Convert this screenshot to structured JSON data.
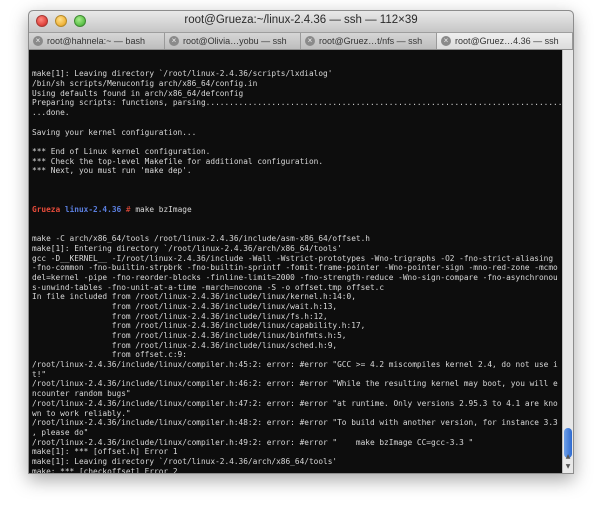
{
  "window": {
    "title": "root@Grueza:~/linux-2.4.36 — ssh — 112×39"
  },
  "tabs": [
    {
      "label": "root@hahnela:~ — bash"
    },
    {
      "label": "root@Olivia…yobu — ssh"
    },
    {
      "label": "root@Gruez…t/nfs — ssh"
    },
    {
      "label": "root@Gruez…4.36 — ssh",
      "active": true
    }
  ],
  "prompt": {
    "host": "Grueza",
    "cwd": "linux-2.4.36",
    "symbol": "#",
    "command": "make bzImage"
  },
  "terminal": {
    "lines_before": [
      "make[1]: Leaving directory `/root/linux-2.4.36/scripts/lxdialog'",
      "/bin/sh scripts/Menuconfig arch/x86_64/config.in",
      "Using defaults found in arch/x86_64/defconfig",
      "Preparing scripts: functions, parsing.................................................................................",
      "...done.",
      "",
      "Saving your kernel configuration...",
      "",
      "*** End of Linux kernel configuration.",
      "*** Check the top-level Makefile for additional configuration.",
      "*** Next, you must run 'make dep'.",
      ""
    ],
    "lines_after": [
      "make -C arch/x86_64/tools /root/linux-2.4.36/include/asm-x86_64/offset.h",
      "make[1]: Entering directory `/root/linux-2.4.36/arch/x86_64/tools'",
      "gcc -D__KERNEL__ -I/root/linux-2.4.36/include -Wall -Wstrict-prototypes -Wno-trigraphs -O2 -fno-strict-aliasing",
      "-fno-common -fno-builtin-strpbrk -fno-builtin-sprintf -fomit-frame-pointer -Wno-pointer-sign -mno-red-zone -mcmo",
      "del=kernel -pipe -fno-reorder-blocks -finline-limit=2000 -fno-strength-reduce -Wno-sign-compare -fno-asynchronou",
      "s-unwind-tables -fno-unit-at-a-time -march=nocona -S -o offset.tmp offset.c",
      "In file included from /root/linux-2.4.36/include/linux/kernel.h:14:0,",
      "                 from /root/linux-2.4.36/include/linux/wait.h:13,",
      "                 from /root/linux-2.4.36/include/linux/fs.h:12,",
      "                 from /root/linux-2.4.36/include/linux/capability.h:17,",
      "                 from /root/linux-2.4.36/include/linux/binfmts.h:5,",
      "                 from /root/linux-2.4.36/include/linux/sched.h:9,",
      "                 from offset.c:9:",
      "/root/linux-2.4.36/include/linux/compiler.h:45:2: error: #error \"GCC >= 4.2 miscompiles kernel 2.4, do not use i",
      "t!\"",
      "/root/linux-2.4.36/include/linux/compiler.h:46:2: error: #error \"While the resulting kernel may boot, you will e",
      "ncounter random bugs\"",
      "/root/linux-2.4.36/include/linux/compiler.h:47:2: error: #error \"at runtime. Only versions 2.95.3 to 4.1 are kno",
      "wn to work reliably.\"",
      "/root/linux-2.4.36/include/linux/compiler.h:48:2: error: #error \"To build with another version, for instance 3.3",
      ", please do\"",
      "/root/linux-2.4.36/include/linux/compiler.h:49:2: error: #error \"    make bzImage CC=gcc-3.3 \"",
      "make[1]: *** [offset.h] Error 1",
      "make[1]: Leaving directory `/root/linux-2.4.36/arch/x86_64/tools'",
      "make: *** [checkoffset] Error 2"
    ]
  }
}
